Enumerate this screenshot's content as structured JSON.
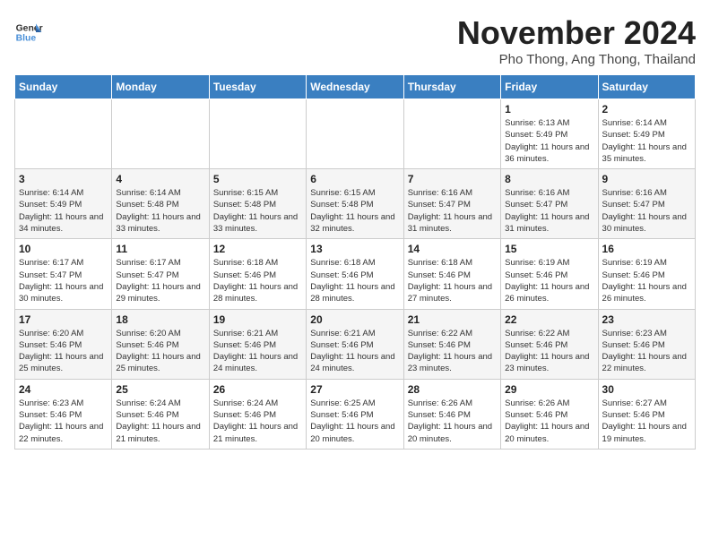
{
  "logo": {
    "line1": "General",
    "line2": "Blue"
  },
  "title": "November 2024",
  "subtitle": "Pho Thong, Ang Thong, Thailand",
  "headers": [
    "Sunday",
    "Monday",
    "Tuesday",
    "Wednesday",
    "Thursday",
    "Friday",
    "Saturday"
  ],
  "weeks": [
    [
      {
        "day": "",
        "info": ""
      },
      {
        "day": "",
        "info": ""
      },
      {
        "day": "",
        "info": ""
      },
      {
        "day": "",
        "info": ""
      },
      {
        "day": "",
        "info": ""
      },
      {
        "day": "1",
        "info": "Sunrise: 6:13 AM\nSunset: 5:49 PM\nDaylight: 11 hours and 36 minutes."
      },
      {
        "day": "2",
        "info": "Sunrise: 6:14 AM\nSunset: 5:49 PM\nDaylight: 11 hours and 35 minutes."
      }
    ],
    [
      {
        "day": "3",
        "info": "Sunrise: 6:14 AM\nSunset: 5:49 PM\nDaylight: 11 hours and 34 minutes."
      },
      {
        "day": "4",
        "info": "Sunrise: 6:14 AM\nSunset: 5:48 PM\nDaylight: 11 hours and 33 minutes."
      },
      {
        "day": "5",
        "info": "Sunrise: 6:15 AM\nSunset: 5:48 PM\nDaylight: 11 hours and 33 minutes."
      },
      {
        "day": "6",
        "info": "Sunrise: 6:15 AM\nSunset: 5:48 PM\nDaylight: 11 hours and 32 minutes."
      },
      {
        "day": "7",
        "info": "Sunrise: 6:16 AM\nSunset: 5:47 PM\nDaylight: 11 hours and 31 minutes."
      },
      {
        "day": "8",
        "info": "Sunrise: 6:16 AM\nSunset: 5:47 PM\nDaylight: 11 hours and 31 minutes."
      },
      {
        "day": "9",
        "info": "Sunrise: 6:16 AM\nSunset: 5:47 PM\nDaylight: 11 hours and 30 minutes."
      }
    ],
    [
      {
        "day": "10",
        "info": "Sunrise: 6:17 AM\nSunset: 5:47 PM\nDaylight: 11 hours and 30 minutes."
      },
      {
        "day": "11",
        "info": "Sunrise: 6:17 AM\nSunset: 5:47 PM\nDaylight: 11 hours and 29 minutes."
      },
      {
        "day": "12",
        "info": "Sunrise: 6:18 AM\nSunset: 5:46 PM\nDaylight: 11 hours and 28 minutes."
      },
      {
        "day": "13",
        "info": "Sunrise: 6:18 AM\nSunset: 5:46 PM\nDaylight: 11 hours and 28 minutes."
      },
      {
        "day": "14",
        "info": "Sunrise: 6:18 AM\nSunset: 5:46 PM\nDaylight: 11 hours and 27 minutes."
      },
      {
        "day": "15",
        "info": "Sunrise: 6:19 AM\nSunset: 5:46 PM\nDaylight: 11 hours and 26 minutes."
      },
      {
        "day": "16",
        "info": "Sunrise: 6:19 AM\nSunset: 5:46 PM\nDaylight: 11 hours and 26 minutes."
      }
    ],
    [
      {
        "day": "17",
        "info": "Sunrise: 6:20 AM\nSunset: 5:46 PM\nDaylight: 11 hours and 25 minutes."
      },
      {
        "day": "18",
        "info": "Sunrise: 6:20 AM\nSunset: 5:46 PM\nDaylight: 11 hours and 25 minutes."
      },
      {
        "day": "19",
        "info": "Sunrise: 6:21 AM\nSunset: 5:46 PM\nDaylight: 11 hours and 24 minutes."
      },
      {
        "day": "20",
        "info": "Sunrise: 6:21 AM\nSunset: 5:46 PM\nDaylight: 11 hours and 24 minutes."
      },
      {
        "day": "21",
        "info": "Sunrise: 6:22 AM\nSunset: 5:46 PM\nDaylight: 11 hours and 23 minutes."
      },
      {
        "day": "22",
        "info": "Sunrise: 6:22 AM\nSunset: 5:46 PM\nDaylight: 11 hours and 23 minutes."
      },
      {
        "day": "23",
        "info": "Sunrise: 6:23 AM\nSunset: 5:46 PM\nDaylight: 11 hours and 22 minutes."
      }
    ],
    [
      {
        "day": "24",
        "info": "Sunrise: 6:23 AM\nSunset: 5:46 PM\nDaylight: 11 hours and 22 minutes."
      },
      {
        "day": "25",
        "info": "Sunrise: 6:24 AM\nSunset: 5:46 PM\nDaylight: 11 hours and 21 minutes."
      },
      {
        "day": "26",
        "info": "Sunrise: 6:24 AM\nSunset: 5:46 PM\nDaylight: 11 hours and 21 minutes."
      },
      {
        "day": "27",
        "info": "Sunrise: 6:25 AM\nSunset: 5:46 PM\nDaylight: 11 hours and 20 minutes."
      },
      {
        "day": "28",
        "info": "Sunrise: 6:26 AM\nSunset: 5:46 PM\nDaylight: 11 hours and 20 minutes."
      },
      {
        "day": "29",
        "info": "Sunrise: 6:26 AM\nSunset: 5:46 PM\nDaylight: 11 hours and 20 minutes."
      },
      {
        "day": "30",
        "info": "Sunrise: 6:27 AM\nSunset: 5:46 PM\nDaylight: 11 hours and 19 minutes."
      }
    ]
  ]
}
